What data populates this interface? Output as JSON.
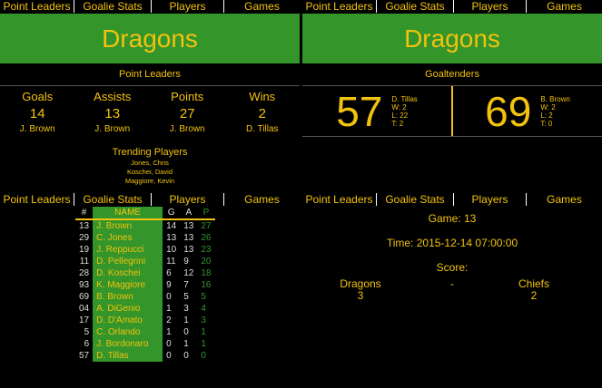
{
  "nav": {
    "tabs": [
      "Point Leaders",
      "Goalie Stats",
      "Players",
      "Games"
    ]
  },
  "team_name": "Dragons",
  "point_leaders": {
    "heading": "Point Leaders",
    "stats": [
      {
        "label": "Goals",
        "value": "14",
        "player": "J. Brown"
      },
      {
        "label": "Assists",
        "value": "13",
        "player": "J. Brown"
      },
      {
        "label": "Points",
        "value": "27",
        "player": "J. Brown"
      },
      {
        "label": "Wins",
        "value": "2",
        "player": "D. Tillas"
      }
    ],
    "trending_title": "Trending Players",
    "trending": [
      "Jones, Chris",
      "Koschei, David",
      "Maggiore, Kevin"
    ]
  },
  "goaltenders": {
    "heading": "Goaltenders",
    "goalies": [
      {
        "number": "57",
        "name": "D. Tillas",
        "w": "W: 2",
        "l": "L: 22",
        "t": "T: 2"
      },
      {
        "number": "69",
        "name": "B. Brown",
        "w": "W: 2",
        "l": "L: 2",
        "t": "T: 0"
      }
    ]
  },
  "roster": {
    "headers": [
      "#",
      "NAME",
      "G",
      "A",
      "P"
    ],
    "rows": [
      {
        "num": "13",
        "name": "J. Brown",
        "g": "14",
        "a": "13",
        "p": "27"
      },
      {
        "num": "29",
        "name": "C. Jones",
        "g": "13",
        "a": "13",
        "p": "26"
      },
      {
        "num": "19",
        "name": "J. Reppucci",
        "g": "10",
        "a": "13",
        "p": "23"
      },
      {
        "num": "11",
        "name": "D. Pellegrini",
        "g": "11",
        "a": "9",
        "p": "20"
      },
      {
        "num": "28",
        "name": "D. Koschei",
        "g": "6",
        "a": "12",
        "p": "18"
      },
      {
        "num": "93",
        "name": "K. Maggiore",
        "g": "9",
        "a": "7",
        "p": "16"
      },
      {
        "num": "69",
        "name": "B. Brown",
        "g": "0",
        "a": "5",
        "p": "5"
      },
      {
        "num": "04",
        "name": "A. DiGenio",
        "g": "1",
        "a": "3",
        "p": "4"
      },
      {
        "num": "17",
        "name": "D. D'Amato",
        "g": "2",
        "a": "1",
        "p": "3"
      },
      {
        "num": "5",
        "name": "C. Orlando",
        "g": "1",
        "a": "0",
        "p": "1"
      },
      {
        "num": "6",
        "name": "J. Bordonaro",
        "g": "0",
        "a": "1",
        "p": "1"
      },
      {
        "num": "57",
        "name": "D. Tillas",
        "g": "0",
        "a": "0",
        "p": "0"
      }
    ]
  },
  "game": {
    "game_label": "Game:  13",
    "time_label": "Time:  2015-12-14 07:00:00",
    "score_label": "Score:",
    "home_team": "Dragons",
    "home_score": "3",
    "separator": "-",
    "away_team": "Chiefs",
    "away_score": "2"
  },
  "colors": {
    "accent": "#f2c20f",
    "green": "#33952a",
    "background": "#000000"
  }
}
